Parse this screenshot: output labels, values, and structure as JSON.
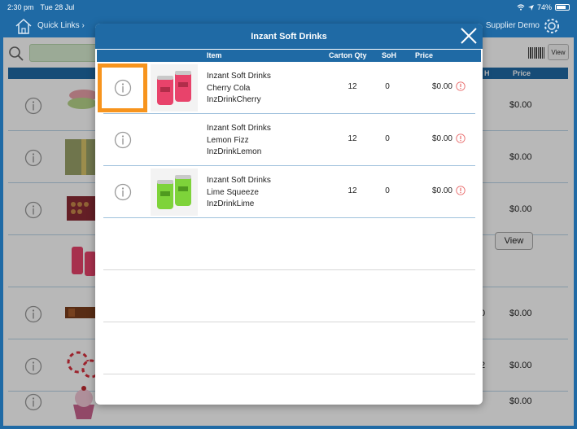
{
  "status_bar": {
    "time": "2:30 pm",
    "date": "Tue 28 Jul",
    "battery": "74%"
  },
  "top_bar": {
    "quick_links": "Quick Links ›",
    "supplier": "Supplier Demo"
  },
  "background": {
    "header_a": "H",
    "header_b": "Price",
    "view_small": "View",
    "view_button": "View",
    "rows": [
      {
        "price": "$0.00",
        "extra": ""
      },
      {
        "price": "$0.00",
        "extra": ""
      },
      {
        "price": "$0.00",
        "extra": ""
      },
      {
        "price": "",
        "extra": ""
      },
      {
        "price": "$0.00",
        "extra": "0"
      },
      {
        "price": "$0.00",
        "extra": "2"
      },
      {
        "price": "$0.00",
        "extra": ""
      }
    ]
  },
  "modal": {
    "title": "Inzant Soft Drinks",
    "columns": {
      "item": "Item",
      "carton_qty": "Carton Qty",
      "soh": "SoH",
      "price": "Price"
    },
    "items": [
      {
        "line1": "Inzant Soft Drinks",
        "line2": "Cherry Cola",
        "line3": "InzDrinkCherry",
        "carton_qty": "12",
        "soh": "0",
        "price": "$0.00",
        "can_color": "#e8436b",
        "has_image": true
      },
      {
        "line1": "Inzant Soft Drinks",
        "line2": "Lemon Fizz",
        "line3": "InzDrinkLemon",
        "carton_qty": "12",
        "soh": "0",
        "price": "$0.00",
        "can_color": "",
        "has_image": false
      },
      {
        "line1": "Inzant Soft Drinks",
        "line2": "Lime Squeeze",
        "line3": "InzDrinkLime",
        "carton_qty": "12",
        "soh": "0",
        "price": "$0.00",
        "can_color": "#7ed33a",
        "has_image": true
      }
    ]
  },
  "colors": {
    "brand_blue": "#1f6aa5",
    "highlight": "#f7941d",
    "alert_red": "#e86a6a"
  }
}
